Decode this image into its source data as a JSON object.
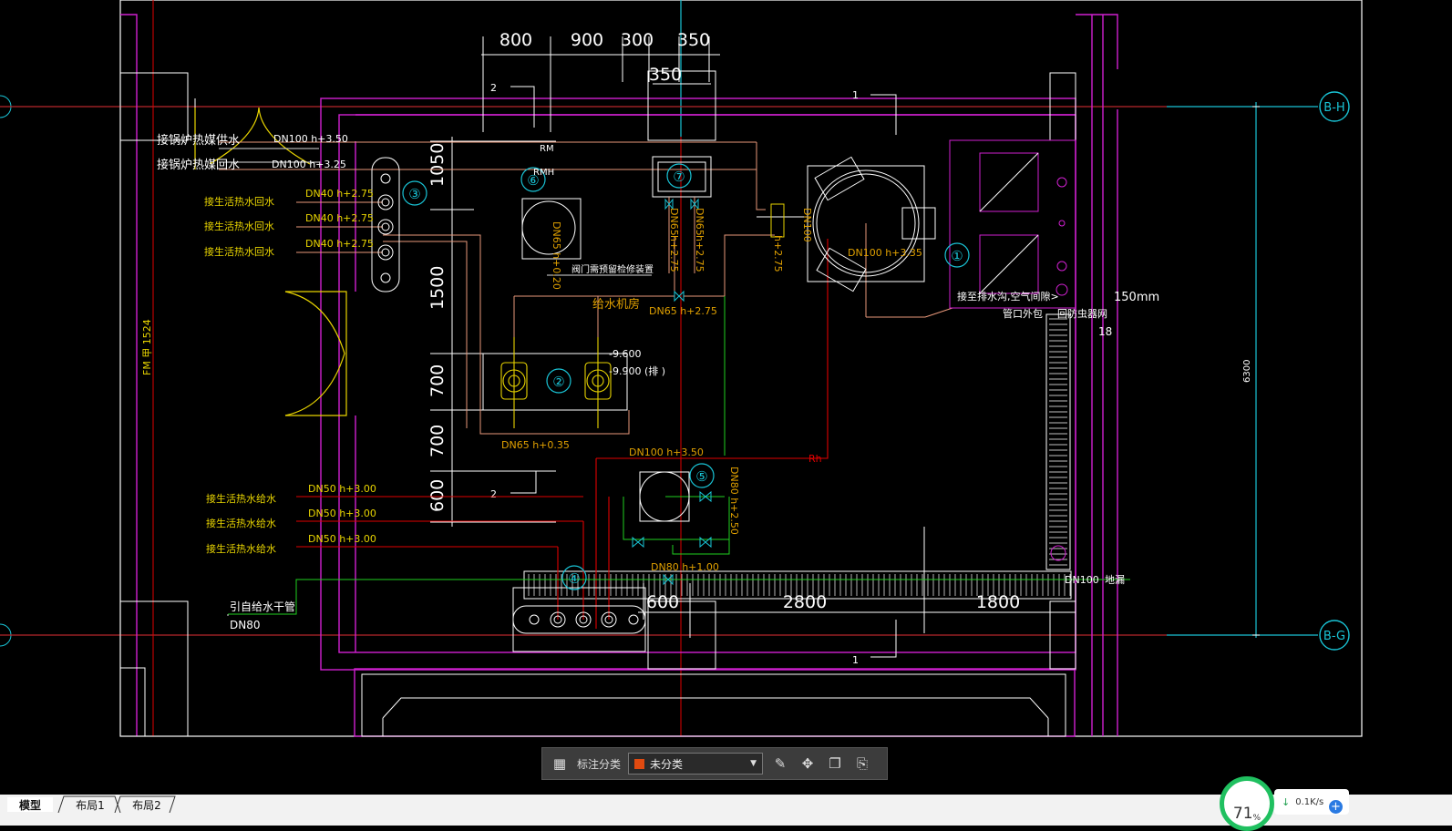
{
  "drawing": {
    "axis_labels": [
      "B-H",
      "B-G"
    ],
    "dims_top": [
      "800",
      "900",
      "300",
      "350"
    ],
    "dim_350b": "350",
    "dims_bottom": [
      "600",
      "2800",
      "1800"
    ],
    "dims_left": [
      "1050",
      "1500",
      "700",
      "700",
      "600"
    ],
    "dim_right": "6300",
    "dim_150mm": "150mm",
    "num_18": "18",
    "section_marks": [
      "1",
      "2",
      "2",
      "1"
    ],
    "door_label": "FM 甲 1524",
    "equipment_tags": [
      "①",
      "②",
      "③",
      "④",
      "⑤",
      "⑥",
      "⑦"
    ],
    "pipe_labels": {
      "boiler_supply": "接锅炉热媒供水",
      "boiler_return": "接锅炉热媒回水",
      "dn100_350": "DN100  h+3.50",
      "dn100_325": "DN100  h+3.25",
      "rm": "RM",
      "rmh": "RMH",
      "hot_return": "接生活热水回水",
      "dn40": "DN40   h+2.75",
      "hot_supply": "接生活热水给水",
      "dn50": "DN50   h+3.00",
      "makeup_main": "引自给水干管",
      "dn80": "DN80",
      "pump_room": "给水机房",
      "dn65_275": "DN65   h+2.75",
      "dn65_035": "DN65   h+0.35",
      "dn100_h350": "DN100   h+3.50",
      "level_1": "-9.600",
      "level_2": "-9.900  (排 )",
      "valve_note": "阀门需预留检修装置",
      "dn80_v": "DN80  h+2.50",
      "dn80_100": "DN80    h+1.00",
      "dn100_335": "DN100   h+3.35",
      "drain_note": "接至排水沟,空气间隙>",
      "drain_note2": "管口外包",
      "net_note": "回防虫器网",
      "dn100_drain": "DN100",
      "drain_trench": "地漏",
      "dn65_v": "DN65",
      "dn65_h275": "h+2.75",
      "dn100_v": "DN100",
      "h275": "h+2.75",
      "dn65_h020": "DN65  h+0.20",
      "rh": "Rh"
    }
  },
  "toolbar": {
    "label": "标注分类",
    "selected": "未分类",
    "swatch_color": "#e04a10"
  },
  "tabs": [
    "模型",
    "布局1",
    "布局2"
  ],
  "status": {
    "gauge_value": "71",
    "gauge_unit": "%",
    "net_speed": "0.1K/s"
  }
}
